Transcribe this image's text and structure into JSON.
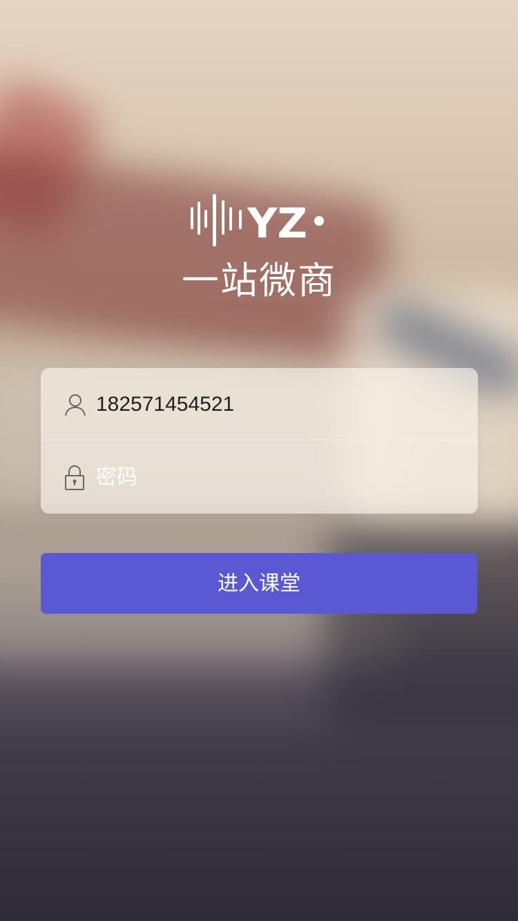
{
  "brand": {
    "logo_text": "YZ",
    "title": "一站微商"
  },
  "login": {
    "username_value": "182571454521",
    "password_placeholder": "密码",
    "username_icon": "user-icon",
    "password_icon": "lock-icon"
  },
  "actions": {
    "submit_label": "进入课堂"
  },
  "colors": {
    "accent": "#5A58D2",
    "card_bg": "#F6F1EA"
  }
}
